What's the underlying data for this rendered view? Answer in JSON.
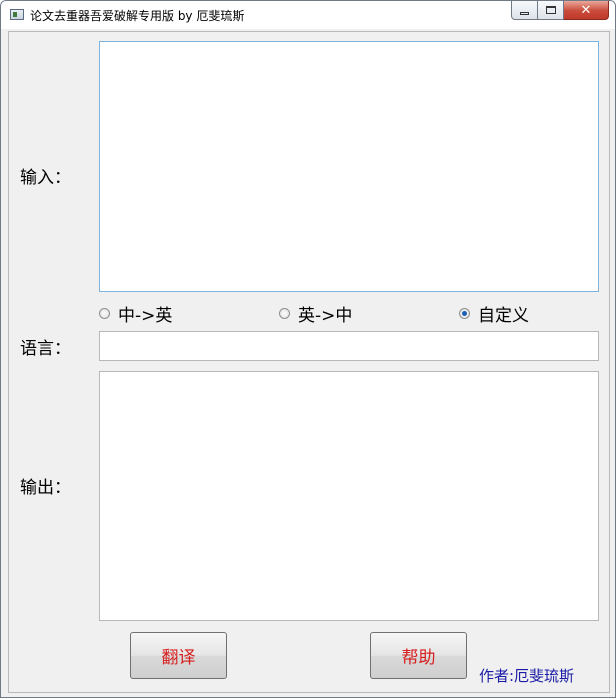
{
  "window": {
    "title": "论文去重器吾爱破解专用版 by 厄斐琉斯",
    "controls": {
      "minimize": "minimize",
      "maximize": "maximize",
      "close": "✕"
    }
  },
  "labels": {
    "input": "输入：",
    "language": "语言：",
    "output": "输出："
  },
  "input_text": {
    "value": ""
  },
  "language_field": {
    "value": ""
  },
  "output_text": {
    "value": ""
  },
  "language_options": [
    {
      "label": "中->英",
      "selected": false
    },
    {
      "label": "英->中",
      "selected": false
    },
    {
      "label": "自定义",
      "selected": true
    }
  ],
  "buttons": {
    "translate": "翻译",
    "help": "帮助"
  },
  "author": "作者:厄斐琉斯",
  "colors": {
    "button_text": "#d61e1e",
    "author_text": "#1a1aa6",
    "radio_selected": "#1a5fb4"
  }
}
